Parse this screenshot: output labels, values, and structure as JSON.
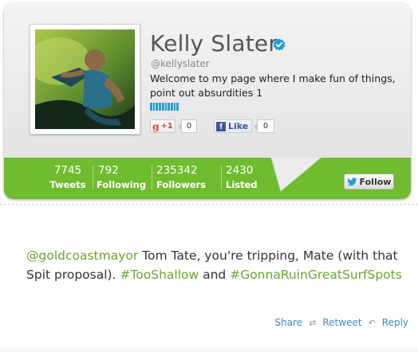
{
  "profile": {
    "name": "Kelly Slater",
    "handle": "@kellyslater",
    "bio": "Welcome to my page where I make fun of things, point out absurdities 1",
    "verified": true
  },
  "social": {
    "gplus_label": "+1",
    "gplus_count": "0",
    "fb_label": "Like",
    "fb_count": "0"
  },
  "stats": [
    {
      "value": "7745",
      "label": "Tweets"
    },
    {
      "value": "792",
      "label": "Following"
    },
    {
      "value": "235342",
      "label": "Followers"
    },
    {
      "value": "2430",
      "label": "Listed"
    }
  ],
  "follow_button": {
    "label": "Follow"
  },
  "tweet": {
    "mention": "@goldcoastmayor",
    "text_a": " Tom Tate, you're tripping, Mate (with that Spit proposal). ",
    "hashtag1": "#TooShallow",
    "text_b": " and ",
    "hashtag2": "#GonnaRuinGreatSurfSpots"
  },
  "actions": {
    "share": "Share",
    "retweet": "Retweet",
    "reply": "Reply"
  },
  "colors": {
    "accent_green": "#6fbc2f",
    "link_green": "#6ba52e",
    "action_blue": "#3f8bc6",
    "verified_blue": "#2b9bd8"
  },
  "icons": {
    "verified": "verified-badge-icon",
    "gplus": "google-plus-icon",
    "facebook": "facebook-icon",
    "twitter": "twitter-bird-icon",
    "retweet": "retweet-icon",
    "reply": "reply-icon"
  }
}
